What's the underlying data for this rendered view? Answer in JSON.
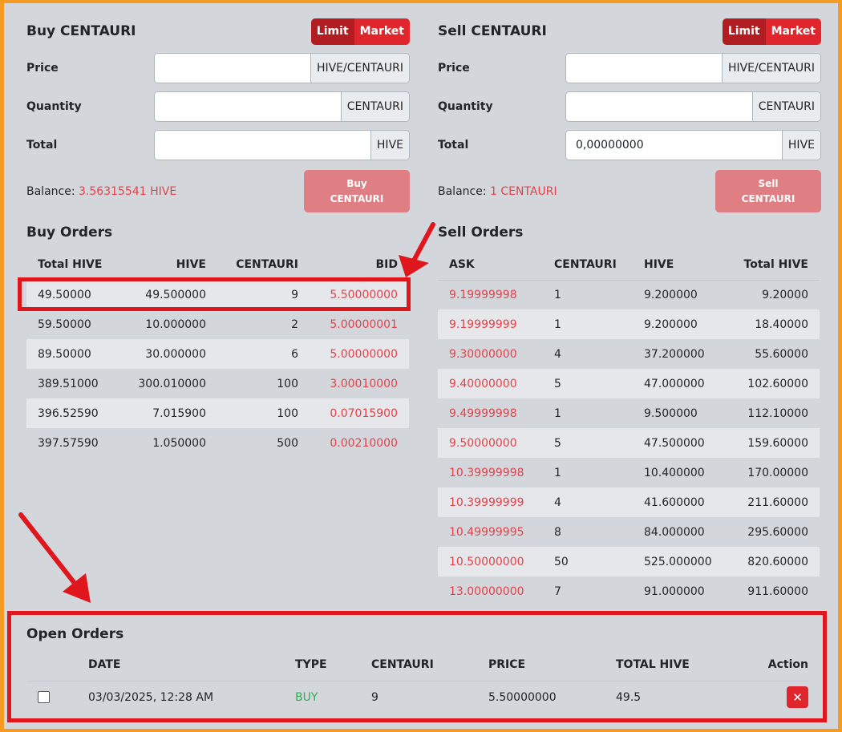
{
  "buy_panel": {
    "title": "Buy CENTAURI",
    "toggle_limit": "Limit",
    "toggle_market": "Market",
    "price_label": "Price",
    "price_unit": "HIVE/CENTAURI",
    "price_value": "",
    "quantity_label": "Quantity",
    "quantity_unit": "CENTAURI",
    "quantity_value": "",
    "total_label": "Total",
    "total_unit": "HIVE",
    "total_value": "",
    "balance_label": "Balance:",
    "balance_value": "3.56315541 HIVE",
    "button_line1": "Buy",
    "button_line2": "CENTAURI"
  },
  "sell_panel": {
    "title": "Sell CENTAURI",
    "toggle_limit": "Limit",
    "toggle_market": "Market",
    "price_label": "Price",
    "price_unit": "HIVE/CENTAURI",
    "price_value": "",
    "quantity_label": "Quantity",
    "quantity_unit": "CENTAURI",
    "quantity_value": "",
    "total_label": "Total",
    "total_unit": "HIVE",
    "total_value": "0,00000000",
    "balance_label": "Balance:",
    "balance_value": "1 CENTAURI",
    "button_line1": "Sell",
    "button_line2": "CENTAURI"
  },
  "buy_orders": {
    "title": "Buy Orders",
    "headers": [
      "Total HIVE",
      "HIVE",
      "CENTAURI",
      "BID"
    ],
    "rows": [
      [
        "49.50000",
        "49.500000",
        "9",
        "5.50000000"
      ],
      [
        "59.50000",
        "10.000000",
        "2",
        "5.00000001"
      ],
      [
        "89.50000",
        "30.000000",
        "6",
        "5.00000000"
      ],
      [
        "389.51000",
        "300.010000",
        "100",
        "3.00010000"
      ],
      [
        "396.52590",
        "7.015900",
        "100",
        "0.07015900"
      ],
      [
        "397.57590",
        "1.050000",
        "500",
        "0.00210000"
      ]
    ]
  },
  "sell_orders": {
    "title": "Sell Orders",
    "headers": [
      "ASK",
      "CENTAURI",
      "HIVE",
      "Total HIVE"
    ],
    "rows": [
      [
        "9.19999998",
        "1",
        "9.200000",
        "9.20000"
      ],
      [
        "9.19999999",
        "1",
        "9.200000",
        "18.40000"
      ],
      [
        "9.30000000",
        "4",
        "37.200000",
        "55.60000"
      ],
      [
        "9.40000000",
        "5",
        "47.000000",
        "102.60000"
      ],
      [
        "9.49999998",
        "1",
        "9.500000",
        "112.10000"
      ],
      [
        "9.50000000",
        "5",
        "47.500000",
        "159.60000"
      ],
      [
        "10.39999998",
        "1",
        "10.400000",
        "170.00000"
      ],
      [
        "10.39999999",
        "4",
        "41.600000",
        "211.60000"
      ],
      [
        "10.49999995",
        "8",
        "84.000000",
        "295.60000"
      ],
      [
        "10.50000000",
        "50",
        "525.000000",
        "820.60000"
      ],
      [
        "13.00000000",
        "7",
        "91.000000",
        "911.60000"
      ]
    ]
  },
  "open_orders": {
    "title": "Open Orders",
    "headers": [
      "",
      "DATE",
      "TYPE",
      "CENTAURI",
      "PRICE",
      "TOTAL HIVE",
      "Action"
    ],
    "rows": [
      {
        "date": "03/03/2025, 12:28 AM",
        "type": "BUY",
        "centauri": "9",
        "price": "5.50000000",
        "total_hive": "49.5",
        "action_icon": "close-icon"
      }
    ]
  },
  "colors": {
    "accent_red": "#e0262c",
    "price_red": "#e3424a",
    "buy_green": "#2fae4f",
    "frame_orange": "#f59a23",
    "annotation_red": "#e0161d"
  }
}
